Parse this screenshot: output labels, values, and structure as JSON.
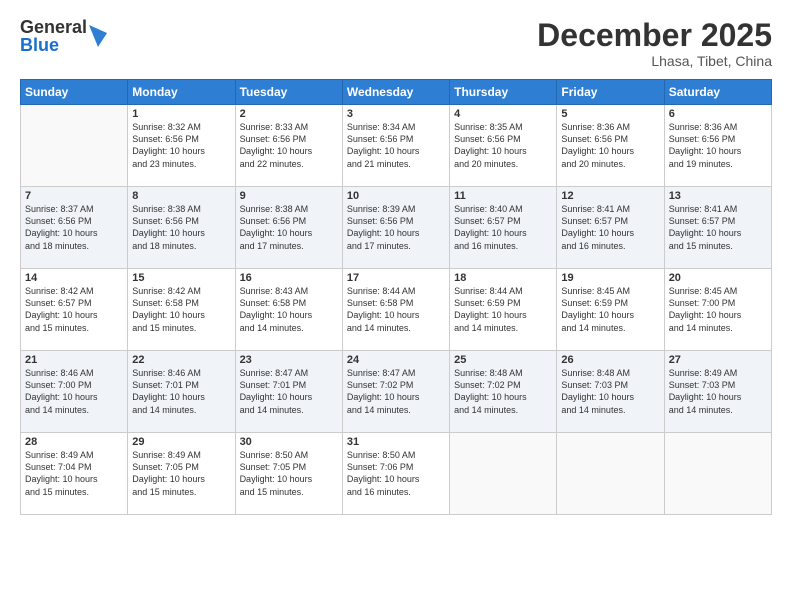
{
  "logo": {
    "general": "General",
    "blue": "Blue"
  },
  "title": "December 2025",
  "location": "Lhasa, Tibet, China",
  "days_of_week": [
    "Sunday",
    "Monday",
    "Tuesday",
    "Wednesday",
    "Thursday",
    "Friday",
    "Saturday"
  ],
  "weeks": [
    [
      {
        "num": "",
        "info": ""
      },
      {
        "num": "1",
        "info": "Sunrise: 8:32 AM\nSunset: 6:56 PM\nDaylight: 10 hours\nand 23 minutes."
      },
      {
        "num": "2",
        "info": "Sunrise: 8:33 AM\nSunset: 6:56 PM\nDaylight: 10 hours\nand 22 minutes."
      },
      {
        "num": "3",
        "info": "Sunrise: 8:34 AM\nSunset: 6:56 PM\nDaylight: 10 hours\nand 21 minutes."
      },
      {
        "num": "4",
        "info": "Sunrise: 8:35 AM\nSunset: 6:56 PM\nDaylight: 10 hours\nand 20 minutes."
      },
      {
        "num": "5",
        "info": "Sunrise: 8:36 AM\nSunset: 6:56 PM\nDaylight: 10 hours\nand 20 minutes."
      },
      {
        "num": "6",
        "info": "Sunrise: 8:36 AM\nSunset: 6:56 PM\nDaylight: 10 hours\nand 19 minutes."
      }
    ],
    [
      {
        "num": "7",
        "info": "Sunrise: 8:37 AM\nSunset: 6:56 PM\nDaylight: 10 hours\nand 18 minutes."
      },
      {
        "num": "8",
        "info": "Sunrise: 8:38 AM\nSunset: 6:56 PM\nDaylight: 10 hours\nand 18 minutes."
      },
      {
        "num": "9",
        "info": "Sunrise: 8:38 AM\nSunset: 6:56 PM\nDaylight: 10 hours\nand 17 minutes."
      },
      {
        "num": "10",
        "info": "Sunrise: 8:39 AM\nSunset: 6:56 PM\nDaylight: 10 hours\nand 17 minutes."
      },
      {
        "num": "11",
        "info": "Sunrise: 8:40 AM\nSunset: 6:57 PM\nDaylight: 10 hours\nand 16 minutes."
      },
      {
        "num": "12",
        "info": "Sunrise: 8:41 AM\nSunset: 6:57 PM\nDaylight: 10 hours\nand 16 minutes."
      },
      {
        "num": "13",
        "info": "Sunrise: 8:41 AM\nSunset: 6:57 PM\nDaylight: 10 hours\nand 15 minutes."
      }
    ],
    [
      {
        "num": "14",
        "info": "Sunrise: 8:42 AM\nSunset: 6:57 PM\nDaylight: 10 hours\nand 15 minutes."
      },
      {
        "num": "15",
        "info": "Sunrise: 8:42 AM\nSunset: 6:58 PM\nDaylight: 10 hours\nand 15 minutes."
      },
      {
        "num": "16",
        "info": "Sunrise: 8:43 AM\nSunset: 6:58 PM\nDaylight: 10 hours\nand 14 minutes."
      },
      {
        "num": "17",
        "info": "Sunrise: 8:44 AM\nSunset: 6:58 PM\nDaylight: 10 hours\nand 14 minutes."
      },
      {
        "num": "18",
        "info": "Sunrise: 8:44 AM\nSunset: 6:59 PM\nDaylight: 10 hours\nand 14 minutes."
      },
      {
        "num": "19",
        "info": "Sunrise: 8:45 AM\nSunset: 6:59 PM\nDaylight: 10 hours\nand 14 minutes."
      },
      {
        "num": "20",
        "info": "Sunrise: 8:45 AM\nSunset: 7:00 PM\nDaylight: 10 hours\nand 14 minutes."
      }
    ],
    [
      {
        "num": "21",
        "info": "Sunrise: 8:46 AM\nSunset: 7:00 PM\nDaylight: 10 hours\nand 14 minutes."
      },
      {
        "num": "22",
        "info": "Sunrise: 8:46 AM\nSunset: 7:01 PM\nDaylight: 10 hours\nand 14 minutes."
      },
      {
        "num": "23",
        "info": "Sunrise: 8:47 AM\nSunset: 7:01 PM\nDaylight: 10 hours\nand 14 minutes."
      },
      {
        "num": "24",
        "info": "Sunrise: 8:47 AM\nSunset: 7:02 PM\nDaylight: 10 hours\nand 14 minutes."
      },
      {
        "num": "25",
        "info": "Sunrise: 8:48 AM\nSunset: 7:02 PM\nDaylight: 10 hours\nand 14 minutes."
      },
      {
        "num": "26",
        "info": "Sunrise: 8:48 AM\nSunset: 7:03 PM\nDaylight: 10 hours\nand 14 minutes."
      },
      {
        "num": "27",
        "info": "Sunrise: 8:49 AM\nSunset: 7:03 PM\nDaylight: 10 hours\nand 14 minutes."
      }
    ],
    [
      {
        "num": "28",
        "info": "Sunrise: 8:49 AM\nSunset: 7:04 PM\nDaylight: 10 hours\nand 15 minutes."
      },
      {
        "num": "29",
        "info": "Sunrise: 8:49 AM\nSunset: 7:05 PM\nDaylight: 10 hours\nand 15 minutes."
      },
      {
        "num": "30",
        "info": "Sunrise: 8:50 AM\nSunset: 7:05 PM\nDaylight: 10 hours\nand 15 minutes."
      },
      {
        "num": "31",
        "info": "Sunrise: 8:50 AM\nSunset: 7:06 PM\nDaylight: 10 hours\nand 16 minutes."
      },
      {
        "num": "",
        "info": ""
      },
      {
        "num": "",
        "info": ""
      },
      {
        "num": "",
        "info": ""
      }
    ]
  ]
}
